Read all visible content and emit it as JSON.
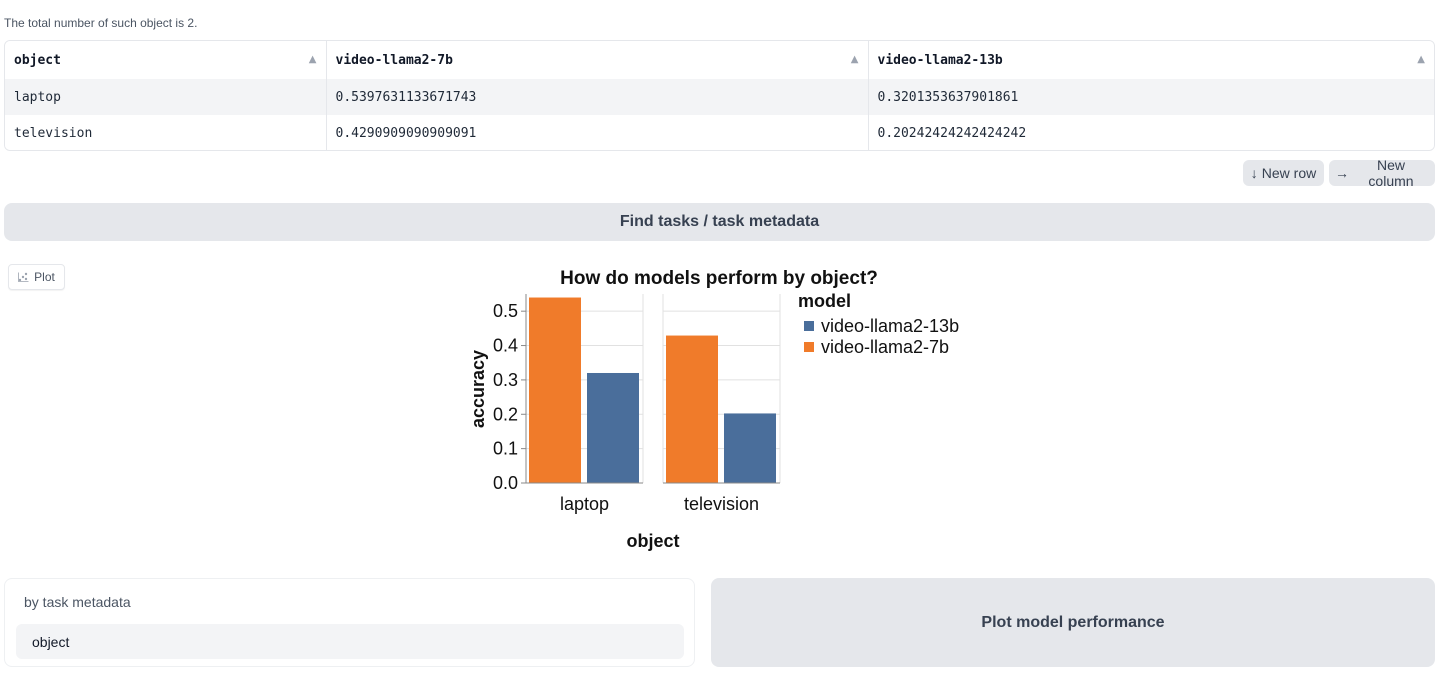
{
  "summary": {
    "total_text": "The total number of such object is 2."
  },
  "table": {
    "headers": [
      "object",
      "video-llama2-7b",
      "video-llama2-13b"
    ],
    "sort_glyph": "▲",
    "rows": [
      [
        "laptop",
        "0.5397631133671743",
        "0.3201353637901861"
      ],
      [
        "television",
        "0.4290909090909091",
        "0.20242424242424242"
      ]
    ]
  },
  "table_actions": {
    "new_row_icon": "↓",
    "new_row_label": "New row",
    "new_column_icon": "→",
    "new_column_label": "New column"
  },
  "find_button": {
    "label": "Find tasks / task metadata"
  },
  "plot_tab": {
    "icon": "scatter-plot-icon",
    "label": "Plot"
  },
  "chart_data": {
    "type": "bar",
    "title": "How do models perform by object?",
    "xlabel": "object",
    "ylabel": "accuracy",
    "categories": [
      "laptop",
      "television"
    ],
    "ylim": [
      0,
      0.55
    ],
    "yticks": [
      "0.0",
      "0.1",
      "0.2",
      "0.3",
      "0.4",
      "0.5"
    ],
    "grid": true,
    "legend": {
      "title": "model",
      "placement": "right"
    },
    "series": [
      {
        "name": "video-llama2-7b",
        "color": "#f07b2a",
        "values": [
          0.5397631133671743,
          0.4290909090909091
        ]
      },
      {
        "name": "video-llama2-13b",
        "color": "#4a6e9b",
        "values": [
          0.3201353637901861,
          0.20242424242424242
        ]
      }
    ],
    "legend_order": [
      "video-llama2-13b",
      "video-llama2-7b"
    ]
  },
  "metadata_panel": {
    "label": "by task metadata",
    "selected": "object"
  },
  "plot_button": {
    "label": "Plot model performance"
  }
}
